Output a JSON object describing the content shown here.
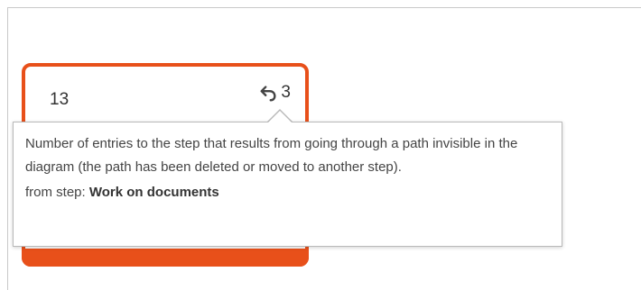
{
  "step": {
    "entries_count": "13",
    "back_icon": "back-arrow-icon",
    "back_entries_count": "3",
    "accent_color": "#e8501a"
  },
  "tooltip": {
    "description": "Number of entries to the step that results from going through a path invisible in the diagram (the path has been deleted or moved to another step).",
    "from_label": "from step: ",
    "from_step_name": "Work on documents"
  }
}
